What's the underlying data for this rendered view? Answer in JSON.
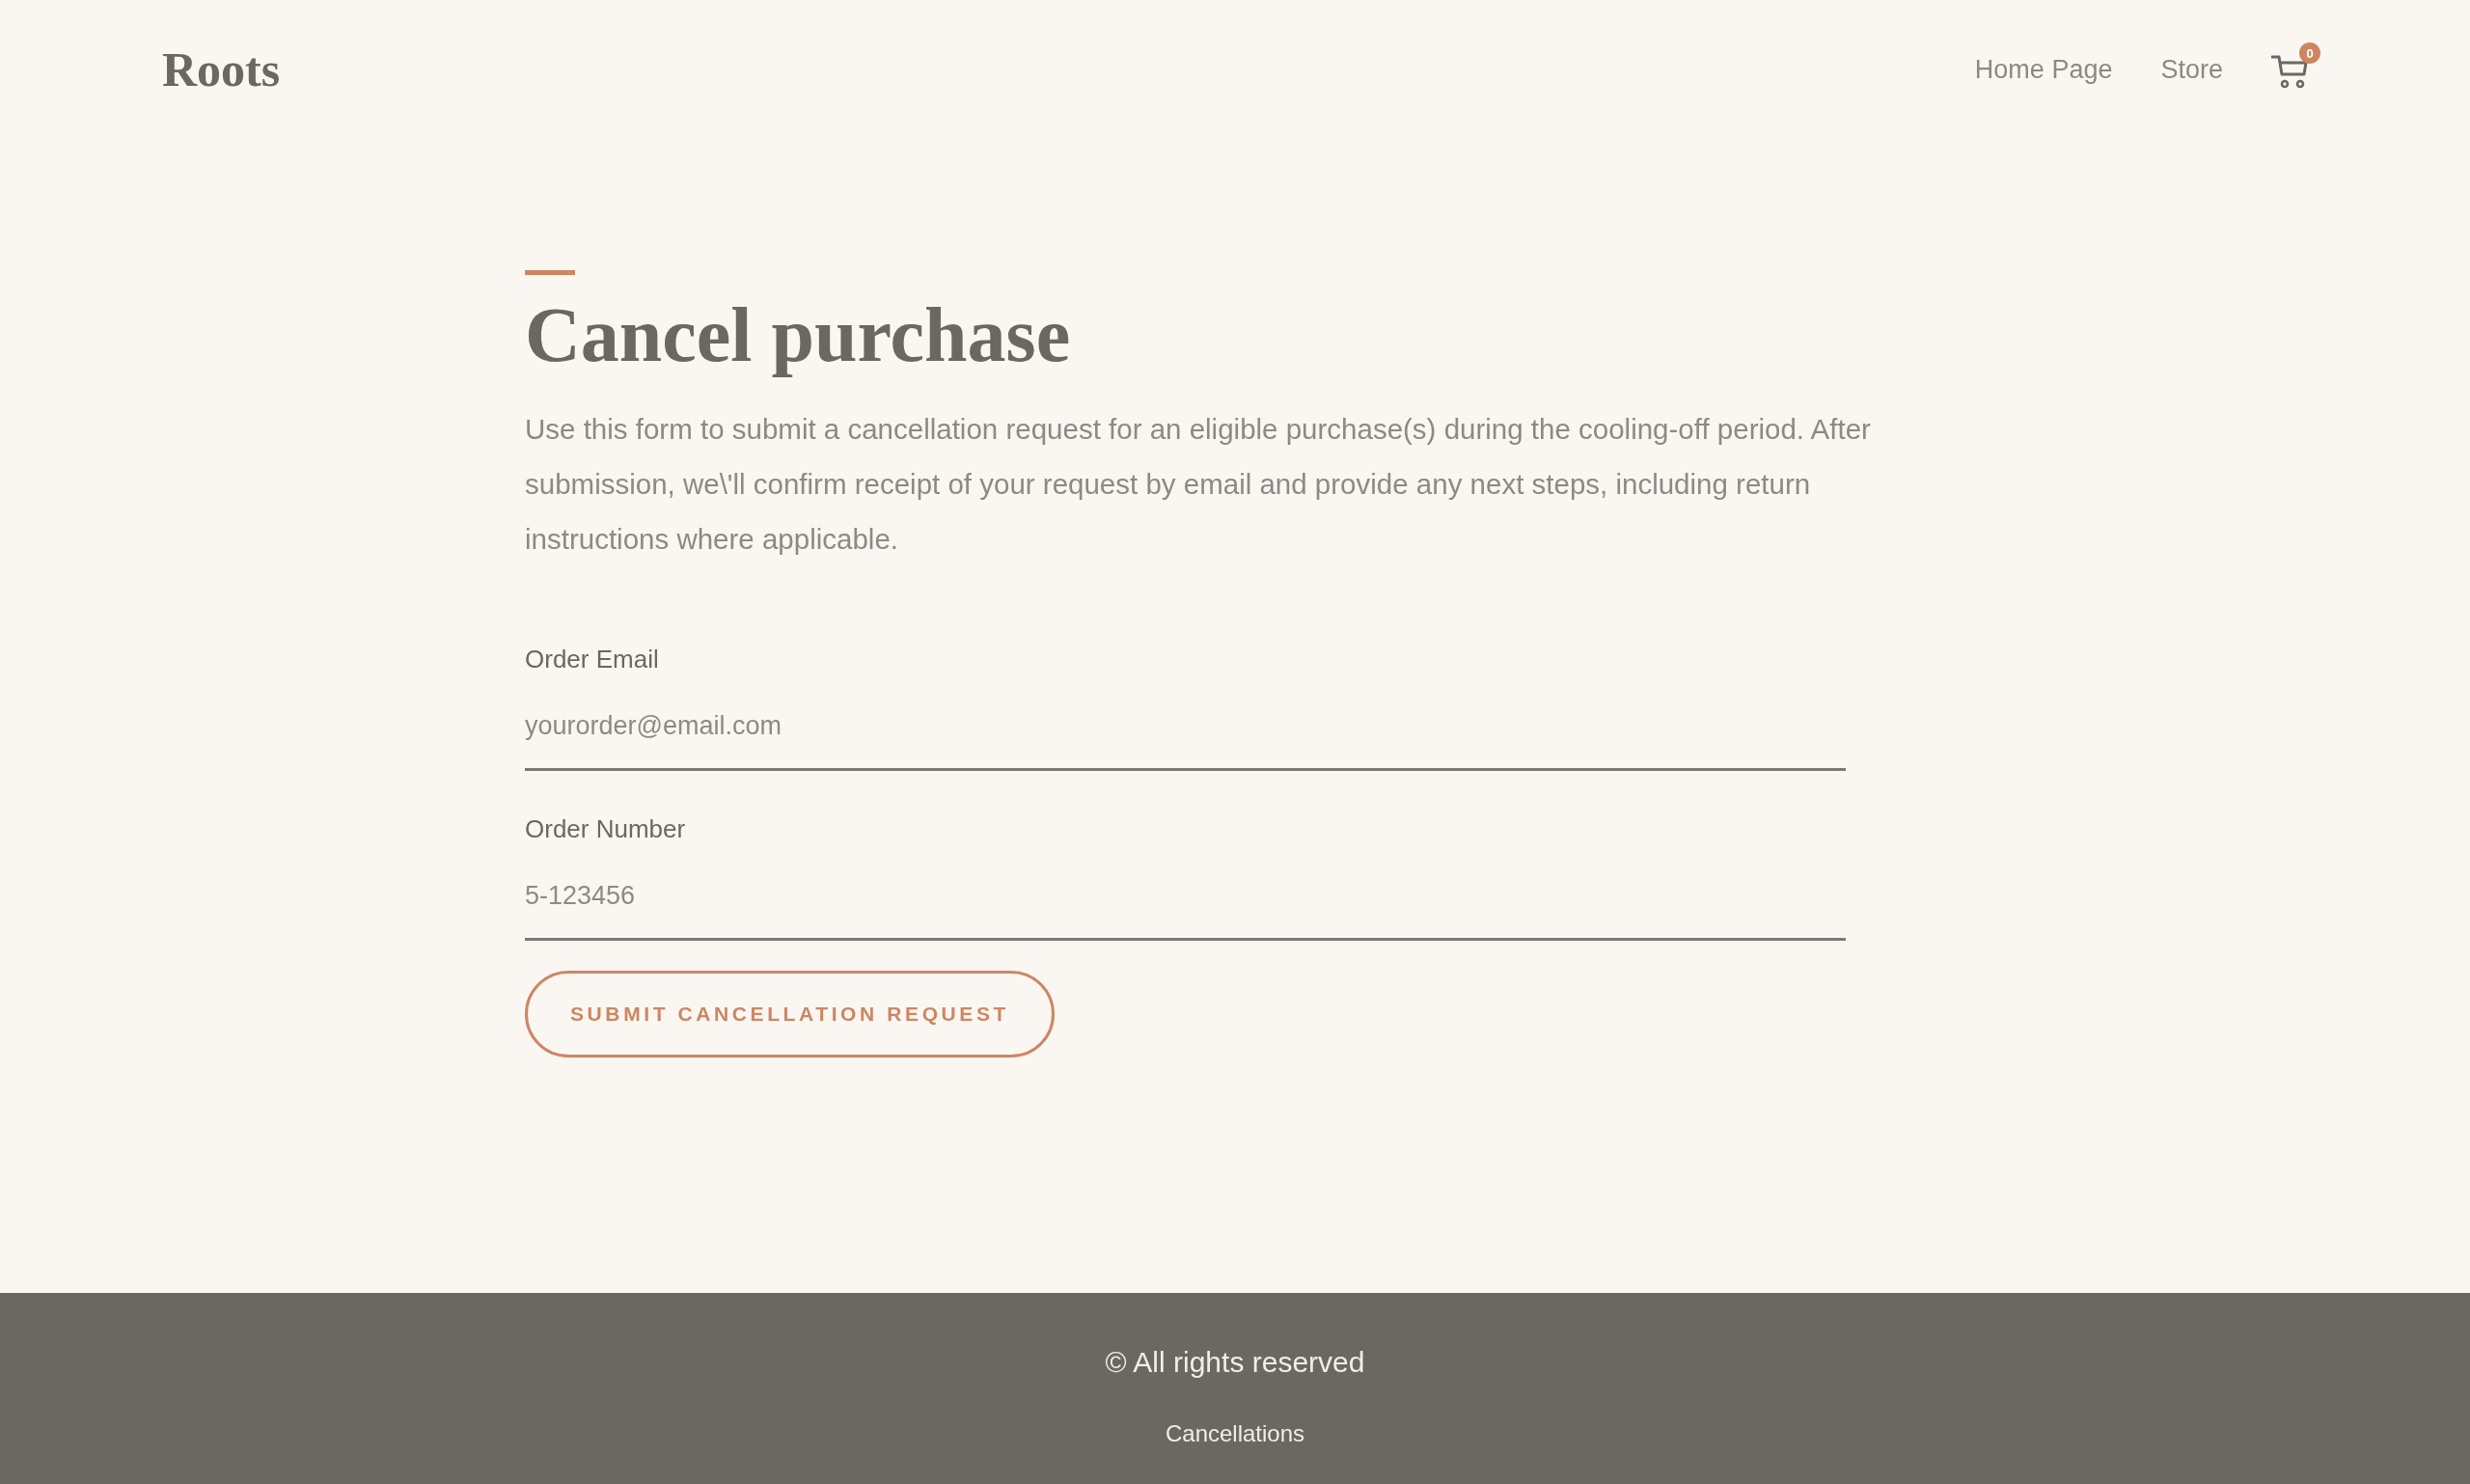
{
  "header": {
    "logo": "Roots",
    "nav": [
      {
        "label": "Home Page"
      },
      {
        "label": "Store"
      }
    ],
    "cart": {
      "count": "0"
    }
  },
  "main": {
    "title": "Cancel purchase",
    "intro": "Use this form to submit a cancellation request for an eligible purchase(s) during the cooling-off period. After submission, we\\'ll confirm receipt of your request by email and provide any next steps, including return instructions where applicable.",
    "form": {
      "fields": [
        {
          "label": "Order Email",
          "placeholder": "yourorder@email.com"
        },
        {
          "label": "Order Number",
          "placeholder": "5-123456"
        }
      ],
      "submit": "SUBMIT CANCELLATION REQUEST"
    }
  },
  "footer": {
    "copyright": "© All rights reserved",
    "links": [
      "Cancellations"
    ]
  }
}
